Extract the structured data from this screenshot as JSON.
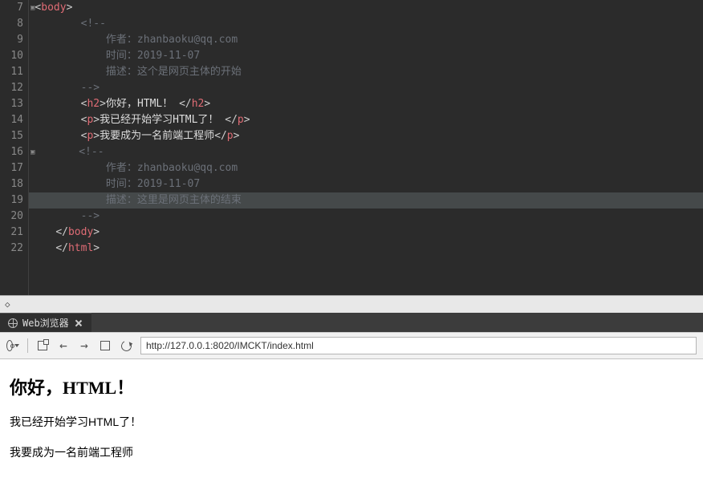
{
  "editor": {
    "lines": [
      {
        "num": "7",
        "indent": 0,
        "type": "open",
        "tag": "body",
        "fold": true
      },
      {
        "num": "8",
        "indent": 2,
        "type": "comment",
        "text": "<!--"
      },
      {
        "num": "9",
        "indent": 3,
        "type": "comment",
        "text": "作者：zhanbaoku@qq.com"
      },
      {
        "num": "10",
        "indent": 3,
        "type": "comment",
        "text": "时间：2019-11-07"
      },
      {
        "num": "11",
        "indent": 3,
        "type": "comment",
        "text": "描述：这个是网页主体的开始"
      },
      {
        "num": "12",
        "indent": 2,
        "type": "comment",
        "text": "-->"
      },
      {
        "num": "13",
        "indent": 2,
        "type": "elem",
        "tag": "h2",
        "text": "你好，HTML！ "
      },
      {
        "num": "14",
        "indent": 2,
        "type": "elem",
        "tag": "p",
        "text": "我已经开始学习HTML了！ "
      },
      {
        "num": "15",
        "indent": 2,
        "type": "elem",
        "tag": "p",
        "text": "我要成为一名前端工程师"
      },
      {
        "num": "16",
        "indent": 2,
        "type": "comment",
        "text": "<!--",
        "fold": true
      },
      {
        "num": "17",
        "indent": 3,
        "type": "comment",
        "text": "作者：zhanbaoku@qq.com"
      },
      {
        "num": "18",
        "indent": 3,
        "type": "comment",
        "text": "时间：2019-11-07"
      },
      {
        "num": "19",
        "indent": 3,
        "type": "comment",
        "text": "描述：这里是网页主体的结束",
        "highlight": true
      },
      {
        "num": "20",
        "indent": 2,
        "type": "comment",
        "text": "-->"
      },
      {
        "num": "21",
        "indent": 1,
        "type": "close",
        "tag": "body"
      },
      {
        "num": "22",
        "indent": 1,
        "type": "close",
        "tag": "html"
      }
    ],
    "status_left": "◇"
  },
  "tab": {
    "title": "Web浏览器"
  },
  "toolbar": {
    "url": "http://127.0.0.1:8020/IMCKT/index.html"
  },
  "preview": {
    "heading": "你好，HTML！",
    "p1": "我已经开始学习HTML了！",
    "p2": "我要成为一名前端工程师"
  }
}
